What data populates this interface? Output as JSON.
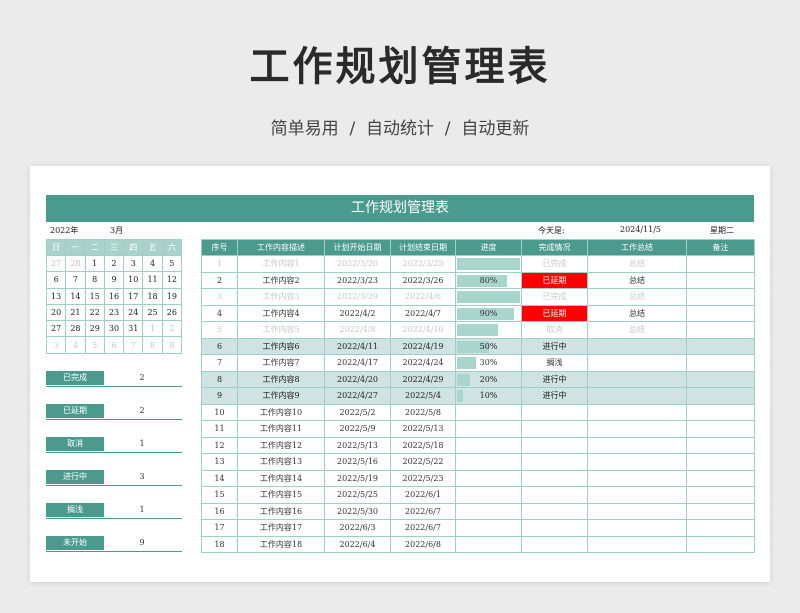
{
  "hero": {
    "title": "工作规划管理表",
    "subtitle": "简单易用  /  自动统计  /  自动更新"
  },
  "sheet": {
    "banner_title": "工作规划管理表",
    "year_label": "2022年",
    "month_label": "3月",
    "today_label": "今天是:",
    "today_value": "2024/11/5",
    "weekday_value": "星期二"
  },
  "calendar": {
    "headers": [
      "日",
      "一",
      "二",
      "三",
      "四",
      "五",
      "六"
    ],
    "weeks": [
      [
        [
          "27",
          true
        ],
        [
          "28",
          true
        ],
        [
          "1",
          false
        ],
        [
          "2",
          false
        ],
        [
          "3",
          false
        ],
        [
          "4",
          false
        ],
        [
          "5",
          false
        ]
      ],
      [
        [
          "6",
          false
        ],
        [
          "7",
          false
        ],
        [
          "8",
          false
        ],
        [
          "9",
          false
        ],
        [
          "10",
          false
        ],
        [
          "11",
          false
        ],
        [
          "12",
          false
        ]
      ],
      [
        [
          "13",
          false
        ],
        [
          "14",
          false
        ],
        [
          "15",
          false
        ],
        [
          "16",
          false
        ],
        [
          "17",
          false
        ],
        [
          "18",
          false
        ],
        [
          "19",
          false
        ]
      ],
      [
        [
          "20",
          false
        ],
        [
          "21",
          false
        ],
        [
          "22",
          false
        ],
        [
          "23",
          false
        ],
        [
          "24",
          false
        ],
        [
          "25",
          false
        ],
        [
          "26",
          false
        ]
      ],
      [
        [
          "27",
          false
        ],
        [
          "28",
          false
        ],
        [
          "29",
          false
        ],
        [
          "30",
          false
        ],
        [
          "31",
          false
        ],
        [
          "1",
          true
        ],
        [
          "2",
          true
        ]
      ],
      [
        [
          "3",
          true
        ],
        [
          "4",
          true
        ],
        [
          "5",
          true
        ],
        [
          "6",
          true
        ],
        [
          "7",
          true
        ],
        [
          "8",
          true
        ],
        [
          "9",
          true
        ]
      ]
    ]
  },
  "stats": [
    {
      "label": "已完成",
      "value": "2"
    },
    {
      "label": "已延期",
      "value": "2"
    },
    {
      "label": "取消",
      "value": "1"
    },
    {
      "label": "进行中",
      "value": "3"
    },
    {
      "label": "搁浅",
      "value": "1"
    },
    {
      "label": "未开始",
      "value": "9"
    }
  ],
  "table": {
    "headers": [
      "序号",
      "工作内容描述",
      "计划开始日期",
      "计划结束日期",
      "进度",
      "完成情况",
      "工作总结",
      "备注"
    ],
    "rows": [
      {
        "no": "1",
        "desc": "工作内容1",
        "start": "2022/3/20",
        "end": "2022/3/25",
        "progress": 100,
        "progress_label": "",
        "status": "已完成",
        "summary": "总结",
        "note": "",
        "style": "faded"
      },
      {
        "no": "2",
        "desc": "工作内容2",
        "start": "2022/3/23",
        "end": "2022/3/26",
        "progress": 80,
        "progress_label": "80%",
        "status": "已延期",
        "summary": "总结",
        "note": "",
        "style": "late"
      },
      {
        "no": "3",
        "desc": "工作内容3",
        "start": "2022/3/29",
        "end": "2022/4/6",
        "progress": 100,
        "progress_label": "",
        "status": "已完成",
        "summary": "总结",
        "note": "",
        "style": "faded"
      },
      {
        "no": "4",
        "desc": "工作内容4",
        "start": "2022/4/2",
        "end": "2022/4/7",
        "progress": 90,
        "progress_label": "90%",
        "status": "已延期",
        "summary": "总结",
        "note": "",
        "style": "late"
      },
      {
        "no": "5",
        "desc": "工作内容5",
        "start": "2022/4/8",
        "end": "2022/4/10",
        "progress": 65,
        "progress_label": "",
        "status": "取消",
        "summary": "总结",
        "note": "",
        "style": "faded"
      },
      {
        "no": "6",
        "desc": "工作内容6",
        "start": "2022/4/11",
        "end": "2022/4/19",
        "progress": 50,
        "progress_label": "50%",
        "status": "进行中",
        "summary": "",
        "note": "",
        "style": "hl"
      },
      {
        "no": "7",
        "desc": "工作内容7",
        "start": "2022/4/17",
        "end": "2022/4/24",
        "progress": 30,
        "progress_label": "30%",
        "status": "搁浅",
        "summary": "",
        "note": "",
        "style": ""
      },
      {
        "no": "8",
        "desc": "工作内容8",
        "start": "2022/4/20",
        "end": "2022/4/29",
        "progress": 20,
        "progress_label": "20%",
        "status": "进行中",
        "summary": "",
        "note": "",
        "style": "hl"
      },
      {
        "no": "9",
        "desc": "工作内容9",
        "start": "2022/4/27",
        "end": "2022/5/4",
        "progress": 10,
        "progress_label": "10%",
        "status": "进行中",
        "summary": "",
        "note": "",
        "style": "hl"
      },
      {
        "no": "10",
        "desc": "工作内容10",
        "start": "2022/5/2",
        "end": "2022/5/8",
        "progress": 0,
        "progress_label": "",
        "status": "",
        "summary": "",
        "note": "",
        "style": ""
      },
      {
        "no": "11",
        "desc": "工作内容11",
        "start": "2022/5/9",
        "end": "2022/5/13",
        "progress": 0,
        "progress_label": "",
        "status": "",
        "summary": "",
        "note": "",
        "style": ""
      },
      {
        "no": "12",
        "desc": "工作内容12",
        "start": "2022/5/13",
        "end": "2022/5/18",
        "progress": 0,
        "progress_label": "",
        "status": "",
        "summary": "",
        "note": "",
        "style": ""
      },
      {
        "no": "13",
        "desc": "工作内容13",
        "start": "2022/5/16",
        "end": "2022/5/22",
        "progress": 0,
        "progress_label": "",
        "status": "",
        "summary": "",
        "note": "",
        "style": ""
      },
      {
        "no": "14",
        "desc": "工作内容14",
        "start": "2022/5/19",
        "end": "2022/5/23",
        "progress": 0,
        "progress_label": "",
        "status": "",
        "summary": "",
        "note": "",
        "style": ""
      },
      {
        "no": "15",
        "desc": "工作内容15",
        "start": "2022/5/25",
        "end": "2022/6/1",
        "progress": 0,
        "progress_label": "",
        "status": "",
        "summary": "",
        "note": "",
        "style": ""
      },
      {
        "no": "16",
        "desc": "工作内容16",
        "start": "2022/5/30",
        "end": "2022/6/7",
        "progress": 0,
        "progress_label": "",
        "status": "",
        "summary": "",
        "note": "",
        "style": ""
      },
      {
        "no": "17",
        "desc": "工作内容17",
        "start": "2022/6/3",
        "end": "2022/6/7",
        "progress": 0,
        "progress_label": "",
        "status": "",
        "summary": "",
        "note": "",
        "style": ""
      },
      {
        "no": "18",
        "desc": "工作内容18",
        "start": "2022/6/4",
        "end": "2022/6/8",
        "progress": 0,
        "progress_label": "",
        "status": "",
        "summary": "",
        "note": "",
        "style": ""
      }
    ]
  },
  "colors": {
    "accent": "#4b9a8e",
    "progress_bar": "#a8d6cd",
    "late": "#ff0000",
    "highlight_row": "#d0e3e3"
  }
}
